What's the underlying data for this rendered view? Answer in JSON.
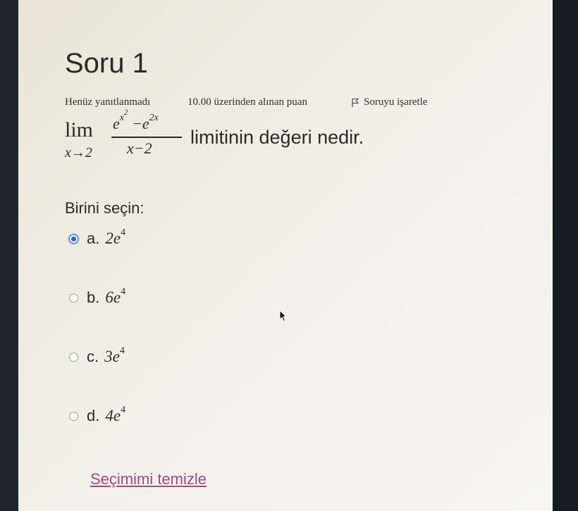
{
  "question": {
    "title": "Soru 1",
    "status": "Henüz yanıtlanmadı",
    "points": "10.00 üzerinden alınan puan",
    "flag_label": "Soruyu işaretle",
    "limit_word": "lim",
    "limit_sub": "x→2",
    "num_left": "e",
    "num_exp_base": "x",
    "num_exp_power": "2",
    "num_minus": " −e",
    "num_right_exp": "2x",
    "denominator": "x−2",
    "text": "limitinin değeri nedir."
  },
  "answer": {
    "prompt": "Birini seçin:",
    "options": [
      {
        "letter": "a.",
        "coef": "2e",
        "power": "4",
        "selected": true
      },
      {
        "letter": "b.",
        "coef": "6e",
        "power": "4",
        "selected": false
      },
      {
        "letter": "c.",
        "coef": "3e",
        "power": "4",
        "selected": false
      },
      {
        "letter": "d.",
        "coef": "4e",
        "power": "4",
        "selected": false
      }
    ],
    "clear_label": "Seçimimi temizle"
  }
}
